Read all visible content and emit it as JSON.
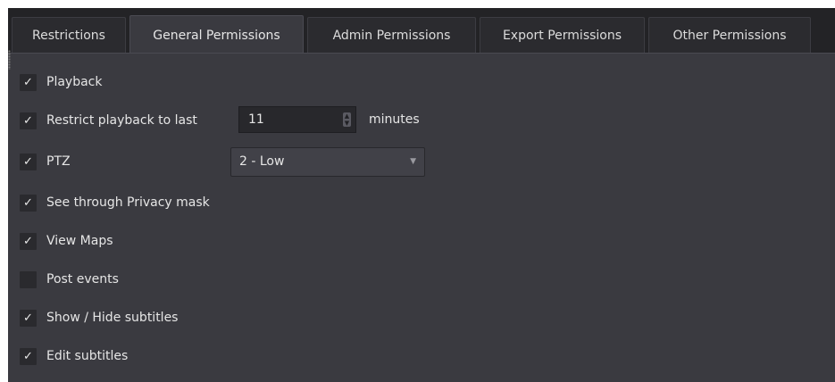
{
  "tabs": [
    {
      "label": "Restrictions",
      "active": false
    },
    {
      "label": "General Permissions",
      "active": true
    },
    {
      "label": "Admin Permissions",
      "active": false
    },
    {
      "label": "Export Permissions",
      "active": false
    },
    {
      "label": "Other Permissions",
      "active": false
    }
  ],
  "permissions": [
    {
      "label": "Playback",
      "checked": true
    },
    {
      "label": "Restrict playback to last",
      "checked": true
    },
    {
      "label": "PTZ",
      "checked": true
    },
    {
      "label": "See through Privacy mask",
      "checked": true
    },
    {
      "label": "View Maps",
      "checked": true
    },
    {
      "label": "Post events",
      "checked": false
    },
    {
      "label": "Show / Hide subtitles",
      "checked": true
    },
    {
      "label": "Edit subtitles",
      "checked": true
    }
  ],
  "check_glyph": "✓",
  "playback_limit": {
    "value": "11",
    "unit": "minutes"
  },
  "ptz_level": {
    "selected": "2 - Low"
  },
  "colors": {
    "background": "#3a3a40",
    "tab_strip": "#232326",
    "text": "#e6e6e6",
    "checkbox": "#2a2a2e"
  },
  "icons": {
    "spin_up": "caret-up-icon",
    "spin_down": "caret-down-icon",
    "dropdown": "chevron-down-icon",
    "check": "checkmark-icon"
  }
}
